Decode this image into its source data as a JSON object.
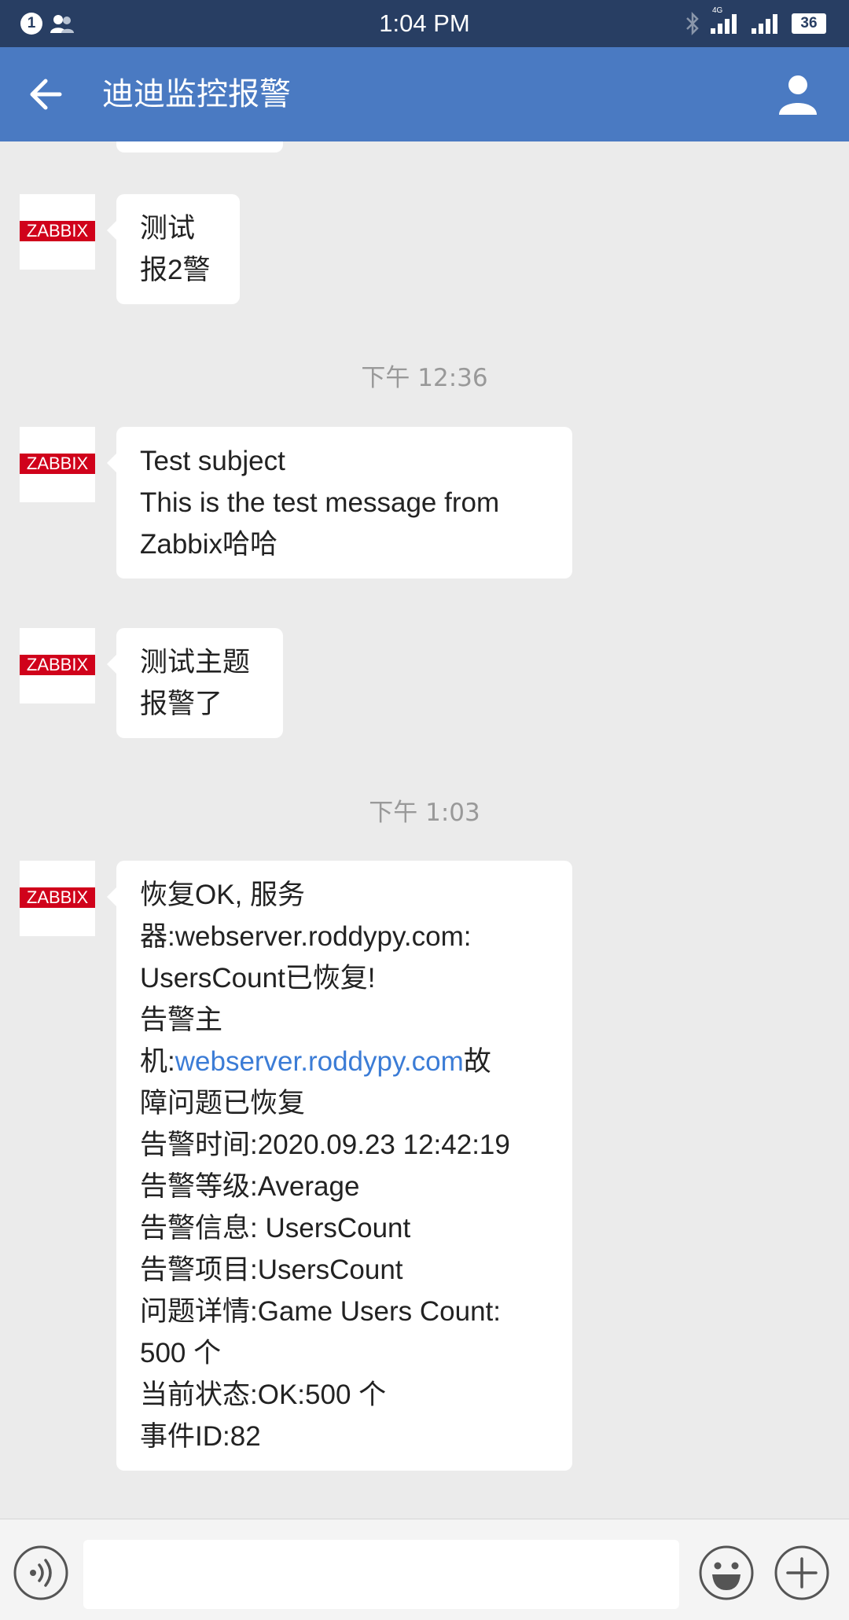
{
  "status_bar": {
    "notification_count": "1",
    "time": "1:04 PM",
    "network": "4G",
    "battery": "36"
  },
  "header": {
    "title": "迪迪监控报警"
  },
  "avatar_logo_text": "ZABBIX",
  "messages": [
    {
      "lines": [
        "测试",
        "报2警"
      ]
    },
    {
      "timestamp": "下午 12:36"
    },
    {
      "lines": [
        "Test subject",
        "This is the test message from",
        "Zabbix哈哈"
      ]
    },
    {
      "lines": [
        "测试主题",
        "报警了"
      ]
    },
    {
      "timestamp": "下午 1:03"
    },
    {
      "lines": [
        "恢复OK, 服务",
        "器:webserver.roddypy.com:",
        "UsersCount已恢复!",
        "告警主",
        "机:",
        "webserver.roddypy.com",
        "故",
        "障问题已恢复",
        "告警时间:2020.09.23 12:42:19",
        "告警等级:Average",
        "告警信息: UsersCount",
        "告警项目:UsersCount",
        "问题详情:Game Users Count:",
        "500 个",
        "当前状态:OK:500 个",
        "事件ID:82"
      ]
    }
  ],
  "input_bar": {
    "placeholder": ""
  },
  "colors": {
    "status_bar": "#283e63",
    "header": "#4a7ac2",
    "background": "#ebebeb",
    "link": "#3b7cd6",
    "zabbix_red": "#d0021b"
  }
}
